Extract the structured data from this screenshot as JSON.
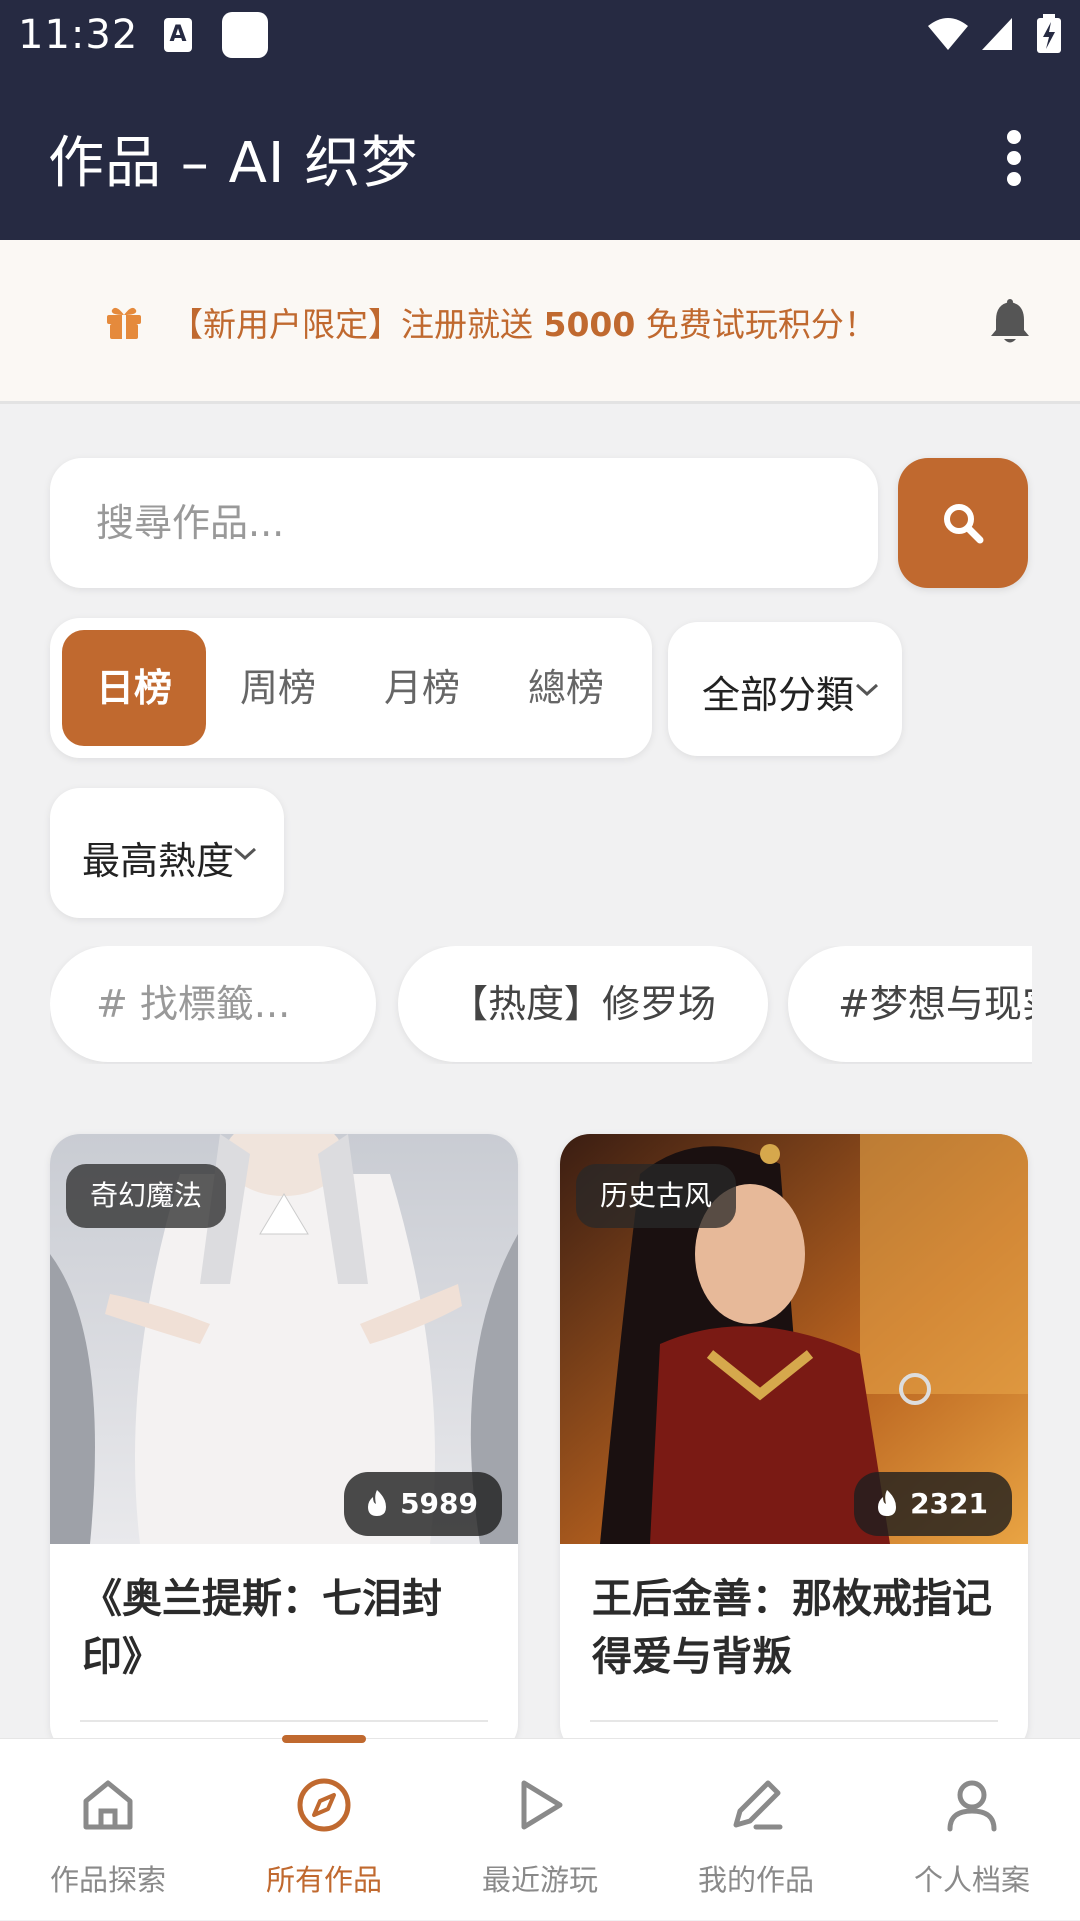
{
  "status_bar": {
    "time": "11:32",
    "icons": [
      "a-notification-icon",
      "square-notification-icon",
      "wifi-icon",
      "signal-icon",
      "battery-charging-icon"
    ]
  },
  "app_bar": {
    "title": "作品 – AI 织梦",
    "menu_icon": "more-vert-icon"
  },
  "banner": {
    "icon": "gift-icon",
    "text_prefix": "【新用户限定】注册就送 ",
    "text_highlight": "5000",
    "text_suffix": " 免费试玩积分！",
    "bell_icon": "bell-icon"
  },
  "search": {
    "placeholder": "搜尋作品...",
    "value": "",
    "button_icon": "search-icon"
  },
  "range_tabs": {
    "items": [
      "日榜",
      "周榜",
      "月榜",
      "總榜"
    ],
    "active_index": 0
  },
  "filters": {
    "category": "全部分類",
    "sort": "最高熱度"
  },
  "tags": {
    "search_placeholder": "# 找標籤...",
    "items": [
      "【热度】修罗场",
      "#梦想与现实"
    ]
  },
  "cards": [
    {
      "genre": "奇幻魔法",
      "heat": "5989",
      "title": "《奥兰提斯：七泪封印》"
    },
    {
      "genre": "历史古风",
      "heat": "2321",
      "title": "王后金善：那枚戒指记得爱与背叛"
    }
  ],
  "bottom_nav": {
    "items": [
      {
        "label": "作品探索",
        "icon": "home-icon"
      },
      {
        "label": "所有作品",
        "icon": "compass-icon"
      },
      {
        "label": "最近游玩",
        "icon": "play-icon"
      },
      {
        "label": "我的作品",
        "icon": "pen-icon"
      },
      {
        "label": "个人档案",
        "icon": "person-icon"
      }
    ],
    "active_index": 1
  },
  "colors": {
    "accent": "#c0692f",
    "app_bar": "#262a42",
    "background": "#f1f1f2"
  }
}
